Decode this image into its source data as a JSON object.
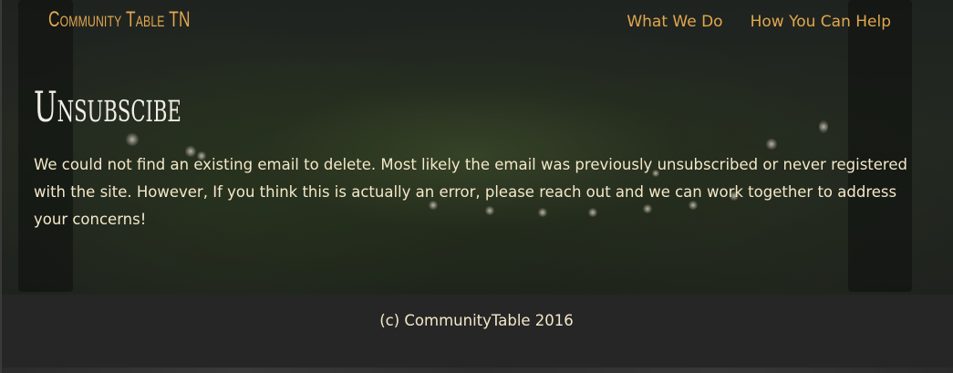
{
  "header": {
    "brand": "Community Table TN",
    "nav": [
      {
        "label": "What We Do"
      },
      {
        "label": "How You Can Help"
      }
    ]
  },
  "main": {
    "title": "Unsubscibe",
    "message": "We could not find an existing email to delete. Most likely the email was previously unsubscribed or never registered with the site. However, If you think this is actually an error, please reach out and we can work together to address your concerns!"
  },
  "footer": {
    "copyright": "(c) CommunityTable 2016"
  },
  "colors": {
    "accent": "#e1a74d",
    "text": "#f4e8c8",
    "title": "#f1eee6",
    "background": "#262626"
  }
}
